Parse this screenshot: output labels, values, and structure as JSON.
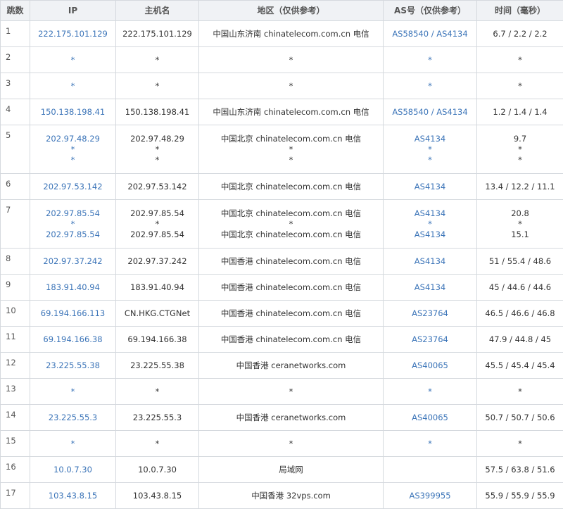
{
  "headers": {
    "hop": "跳数",
    "ip": "IP",
    "host": "主机名",
    "region": "地区（仅供参考）",
    "as": "AS号（仅供参考）",
    "time": "时间（毫秒）"
  },
  "rows": [
    {
      "hop": "1",
      "ip": [
        "222.175.101.129"
      ],
      "host": [
        "222.175.101.129"
      ],
      "region": [
        "中国山东济南 chinatelecom.com.cn 电信"
      ],
      "as": [
        [
          "AS58540",
          "AS4134"
        ]
      ],
      "time": [
        "6.7 / 2.2 / 2.2"
      ]
    },
    {
      "hop": "2",
      "ip": [
        "*"
      ],
      "host": [
        "*"
      ],
      "region": [
        "*"
      ],
      "as": [
        [
          "*"
        ]
      ],
      "time": [
        "*"
      ]
    },
    {
      "hop": "3",
      "ip": [
        "*"
      ],
      "host": [
        "*"
      ],
      "region": [
        "*"
      ],
      "as": [
        [
          "*"
        ]
      ],
      "time": [
        "*"
      ]
    },
    {
      "hop": "4",
      "ip": [
        "150.138.198.41"
      ],
      "host": [
        "150.138.198.41"
      ],
      "region": [
        "中国山东济南 chinatelecom.com.cn 电信"
      ],
      "as": [
        [
          "AS58540",
          "AS4134"
        ]
      ],
      "time": [
        "1.2 / 1.4 / 1.4"
      ]
    },
    {
      "hop": "5",
      "ip": [
        "202.97.48.29",
        "*",
        "*"
      ],
      "host": [
        "202.97.48.29",
        "*",
        "*"
      ],
      "region": [
        "中国北京 chinatelecom.com.cn 电信",
        "*",
        "*"
      ],
      "as": [
        [
          "AS4134"
        ],
        [
          "*"
        ],
        [
          "*"
        ]
      ],
      "time": [
        "9.7",
        "*",
        "*"
      ]
    },
    {
      "hop": "6",
      "ip": [
        "202.97.53.142"
      ],
      "host": [
        "202.97.53.142"
      ],
      "region": [
        "中国北京 chinatelecom.com.cn 电信"
      ],
      "as": [
        [
          "AS4134"
        ]
      ],
      "time": [
        "13.4 / 12.2 / 11.1"
      ]
    },
    {
      "hop": "7",
      "ip": [
        "202.97.85.54",
        "*",
        "202.97.85.54"
      ],
      "host": [
        "202.97.85.54",
        "*",
        "202.97.85.54"
      ],
      "region": [
        "中国北京 chinatelecom.com.cn 电信",
        "*",
        "中国北京 chinatelecom.com.cn 电信"
      ],
      "as": [
        [
          "AS4134"
        ],
        [
          "*"
        ],
        [
          "AS4134"
        ]
      ],
      "time": [
        "20.8",
        "*",
        "15.1"
      ]
    },
    {
      "hop": "8",
      "ip": [
        "202.97.37.242"
      ],
      "host": [
        "202.97.37.242"
      ],
      "region": [
        "中国香港 chinatelecom.com.cn 电信"
      ],
      "as": [
        [
          "AS4134"
        ]
      ],
      "time": [
        "51 / 55.4 / 48.6"
      ]
    },
    {
      "hop": "9",
      "ip": [
        "183.91.40.94"
      ],
      "host": [
        "183.91.40.94"
      ],
      "region": [
        "中国香港 chinatelecom.com.cn 电信"
      ],
      "as": [
        [
          "AS4134"
        ]
      ],
      "time": [
        "45 / 44.6 / 44.6"
      ]
    },
    {
      "hop": "10",
      "ip": [
        "69.194.166.113"
      ],
      "host": [
        "CN.HKG.CTGNet"
      ],
      "region": [
        "中国香港 chinatelecom.com.cn 电信"
      ],
      "as": [
        [
          "AS23764"
        ]
      ],
      "time": [
        "46.5 / 46.6 / 46.8"
      ]
    },
    {
      "hop": "11",
      "ip": [
        "69.194.166.38"
      ],
      "host": [
        "69.194.166.38"
      ],
      "region": [
        "中国香港 chinatelecom.com.cn 电信"
      ],
      "as": [
        [
          "AS23764"
        ]
      ],
      "time": [
        "47.9 / 44.8 / 45"
      ]
    },
    {
      "hop": "12",
      "ip": [
        "23.225.55.38"
      ],
      "host": [
        "23.225.55.38"
      ],
      "region": [
        "中国香港 ceranetworks.com"
      ],
      "as": [
        [
          "AS40065"
        ]
      ],
      "time": [
        "45.5 / 45.4 / 45.4"
      ]
    },
    {
      "hop": "13",
      "ip": [
        "*"
      ],
      "host": [
        "*"
      ],
      "region": [
        "*"
      ],
      "as": [
        [
          "*"
        ]
      ],
      "time": [
        "*"
      ]
    },
    {
      "hop": "14",
      "ip": [
        "23.225.55.3"
      ],
      "host": [
        "23.225.55.3"
      ],
      "region": [
        "中国香港 ceranetworks.com"
      ],
      "as": [
        [
          "AS40065"
        ]
      ],
      "time": [
        "50.7 / 50.7 / 50.6"
      ]
    },
    {
      "hop": "15",
      "ip": [
        "*"
      ],
      "host": [
        "*"
      ],
      "region": [
        "*"
      ],
      "as": [
        [
          "*"
        ]
      ],
      "time": [
        "*"
      ]
    },
    {
      "hop": "16",
      "ip": [
        "10.0.7.30"
      ],
      "host": [
        "10.0.7.30"
      ],
      "region": [
        "局域网"
      ],
      "as": [
        []
      ],
      "time": [
        "57.5 / 63.8 / 51.6"
      ]
    },
    {
      "hop": "17",
      "ip": [
        "103.43.8.15"
      ],
      "host": [
        "103.43.8.15"
      ],
      "region": [
        "中国香港 32vps.com"
      ],
      "as": [
        [
          "AS399955"
        ]
      ],
      "time": [
        "55.9 / 55.9 / 55.9"
      ]
    }
  ],
  "colors": {
    "link": "#3b74b8",
    "header_bg": "#f0f2f5",
    "border": "#d5d9de",
    "text": "#333333"
  }
}
